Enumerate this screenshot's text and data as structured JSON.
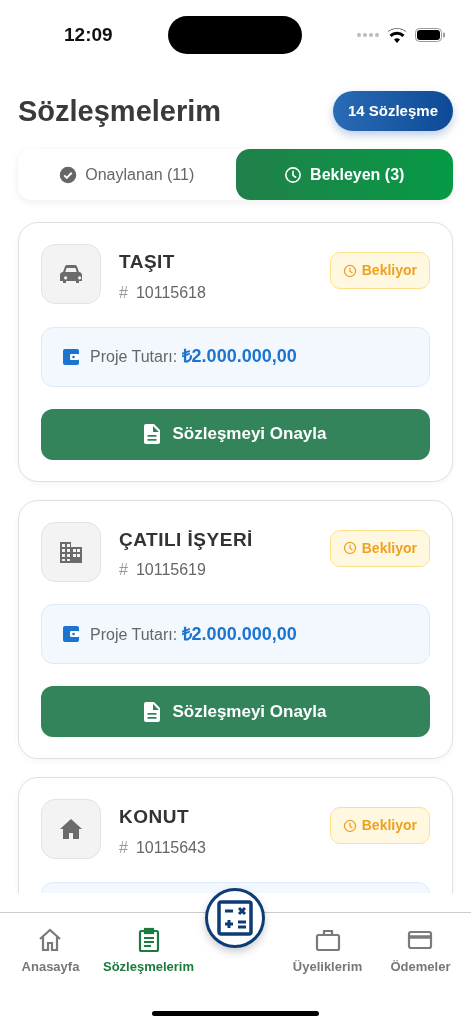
{
  "status_bar": {
    "time": "12:09"
  },
  "header": {
    "title": "Sözleşmelerim",
    "count_badge": "14 Sözleşme"
  },
  "tabs": [
    {
      "label": "Onaylanan (11)",
      "kind": "check",
      "selected": false
    },
    {
      "label": "Bekleyen (3)",
      "kind": "clock",
      "selected": true
    }
  ],
  "contracts": [
    {
      "kind": "car",
      "title": "TAŞIT",
      "number_prefix": "#",
      "number": "10115618",
      "status": "Bekliyor",
      "amount_label": "Proje Tutarı:",
      "amount": "₺2.000.000,00",
      "action": "Sözleşmeyi Onayla"
    },
    {
      "kind": "building",
      "title": "ÇATILI İŞYERİ",
      "number_prefix": "#",
      "number": "10115619",
      "status": "Bekliyor",
      "amount_label": "Proje Tutarı:",
      "amount": "₺2.000.000,00",
      "action": "Sözleşmeyi Onayla"
    },
    {
      "kind": "home",
      "title": "KONUT",
      "number_prefix": "#",
      "number": "10115643",
      "status": "Bekliyor"
    }
  ],
  "tab_bar": [
    {
      "kind": "home",
      "label": "Anasayfa",
      "selected": false
    },
    {
      "kind": "clipboard",
      "label": "Sözleşmelerim",
      "selected": true
    },
    {
      "kind": "calculator"
    },
    {
      "kind": "briefcase",
      "label": "Üyeliklerim",
      "selected": false
    },
    {
      "kind": "card",
      "label": "Ödemeler",
      "selected": false
    }
  ]
}
